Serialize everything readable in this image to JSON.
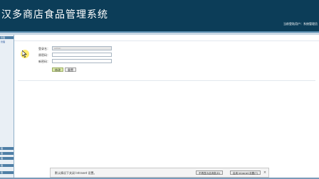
{
  "header": {
    "title": "汉多商店食品管理系统",
    "user_info": "当前登陆用户：系统管理员"
  },
  "sidebar": {
    "items": [
      {
        "label": "管理",
        "sub": "管理"
      },
      {
        "label": "理"
      },
      {
        "label": "理"
      },
      {
        "label": "理"
      },
      {
        "label": "理"
      },
      {
        "label": "理"
      }
    ]
  },
  "form": {
    "fields": [
      {
        "label": "登录名：",
        "value": "admin",
        "placeholder": ""
      },
      {
        "label": "原密码：",
        "value": "",
        "placeholder": ""
      },
      {
        "label": "新密码：",
        "value": "",
        "placeholder": ""
      }
    ],
    "submit_label": "修改",
    "reset_label": "重置"
  },
  "notification": {
    "text": "默认情况下关闭 Intranet 设置。",
    "dismiss_label": "不再显示此消息(D)",
    "enable_label": "启用 Intranet 设置(T)",
    "close_symbol": "×"
  },
  "colors": {
    "header_bg": "#0c3d58",
    "sidebar_head": "#4f7fa6",
    "primary_button": "#d9e8a8"
  }
}
